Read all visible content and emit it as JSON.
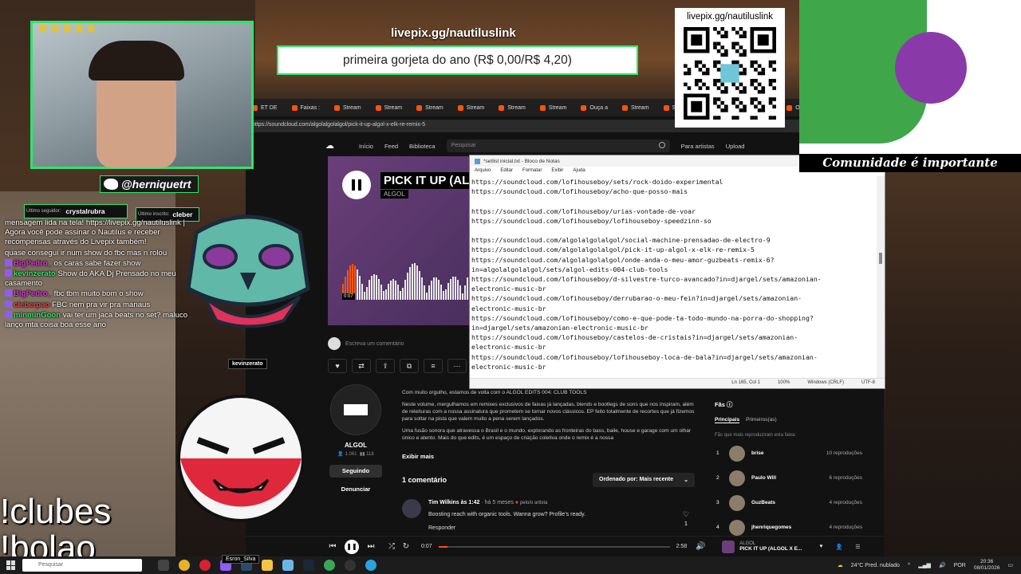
{
  "donation": {
    "url": "livepix.gg/nautiluslink",
    "goal_text": "primeira gorjeta do ano (R$ 0,00/R$ 4,20)"
  },
  "qr": {
    "label": "livepix.gg/nautiluslink"
  },
  "comic": {
    "banner": "Comunidade é importante"
  },
  "camera": {
    "rating_stars": 5
  },
  "social": {
    "twitter": "@herniquetrt",
    "last_follower_label": "Último seguidor:",
    "last_follower": "crystalrubra",
    "last_sub_label": "Último inscrito:",
    "last_sub": "cleber"
  },
  "chat": {
    "messages": [
      {
        "user": "",
        "text": "mensagem lida na tela! https://livepix.gg/nautiluslink | Agora você pode assinar o Nautilus e receber recompensas através do Livepix também!",
        "color": "#ffffff"
      },
      {
        "user": "",
        "text": "quase consegui ir num show do fbc mas n rolou",
        "color": "#8f5cf7"
      },
      {
        "user": "BigPedro_",
        "text": "os caras sabe fazer show",
        "color": "#d13bd1"
      },
      {
        "user": "kevinzerato",
        "text": "Show do AKA Dj Prensado no meu casamento",
        "color": "#2ee56b"
      },
      {
        "user": "BigPedro_",
        "text": "fbc tbm muito bom o show",
        "color": "#d13bd1"
      },
      {
        "user": "cleberpao",
        "text": "FBC nem pra vir pra manaus",
        "color": "#e24a4a"
      },
      {
        "user": "minminGoon",
        "text": "vai ter um jaca beats no set? maluco lanço mta coisa boa esse ano",
        "color": "#2ee56b"
      }
    ]
  },
  "commands": {
    "line1": "!clubes",
    "line2": "!bolao"
  },
  "name_tags": {
    "kevin": "kevinzerato",
    "esron": "Esron_Silva"
  },
  "browser": {
    "tabs": [
      "ET DE",
      "Faixas :",
      "Stream",
      "Stream",
      "Stream",
      "Stream",
      "Stream",
      "Stream",
      "Ouça a",
      "Stream",
      "Stream",
      "Stream",
      "Stream",
      "Ouça a"
    ],
    "url": "https://soundcloud.com/algolalgolalgol/pick-it-up-algol-x-elk-re-remix-5"
  },
  "soundcloud": {
    "nav": {
      "home": "Início",
      "feed": "Feed",
      "library": "Biblioteca",
      "search_placeholder": "Pesquisar",
      "for_artists": "Para artistas",
      "upload": "Upload"
    },
    "track": {
      "title": "PICK IT UP (ALG",
      "artist": "ALGOL",
      "wave_time": "0:07"
    },
    "comment_placeholder": "Escreva um comentário",
    "artist": {
      "name": "ALGOL",
      "followers": "1.061",
      "tracks": "118",
      "follow": "Seguindo",
      "report": "Denunciar"
    },
    "description": [
      "Com muito orgulho, estamos de volta com o ALGOL EDITS 004: CLUB TOOLS",
      "Neste volume, mergulhamos em remixes exclusivos de faixas já lançadas, blends e bootlegs de sons que nos inspiram, além de releituras com a nossa assinatura que prometem se tornar novos clássicos. EP feito totalmente de recortes que já fizemos para soltar na pista que valem muito a pena serem lançados.",
      "Uma fusão sonora que atravessa o Brasil e o mundo, explorando as fronteiras do bass, baile, house e garage com um olhar único e atento. Mais do que edits, é um espaço de criação coletiva onde o remix é a nossa"
    ],
    "show_more": "Exibir mais",
    "comments_count": "1 comentário",
    "sort": "Ordenado por: Mais recente",
    "comment": {
      "user": "Tim Wilkins às 1:42",
      "meta": "· há 5 meses",
      "artist_tag": "pelo/o artista",
      "text": "Boosting reach with organic tools. Wanna grow? Profile's ready.",
      "reply": "Responder",
      "likes": "1"
    },
    "fans": {
      "title": "Fãs",
      "tab_top": "Principais",
      "tab_first": "Primeiros(as)",
      "subtitle": "Fãs que mais reproduziram esta faixa:",
      "list": [
        {
          "rank": "1",
          "name": "brise",
          "plays": "10 reproduções"
        },
        {
          "rank": "2",
          "name": "Paulo Will",
          "plays": "6 reproduções"
        },
        {
          "rank": "3",
          "name": "GuzBeats",
          "plays": "4 reproduções"
        },
        {
          "rank": "4",
          "name": "jhenriquegomes",
          "plays": "4 reproduções"
        }
      ]
    },
    "player": {
      "elapsed": "0:07",
      "duration": "2:58",
      "progress": 0.04,
      "artist": "ALGOL",
      "title": "PICK IT UP (ALGOL X E..."
    }
  },
  "notepad": {
    "title": "*setlist inicial.txt - Bloco de Notas",
    "menu": [
      "Arquivo",
      "Editar",
      "Formatar",
      "Exibir",
      "Ajuda"
    ],
    "lines": [
      "https://soundcloud.com/lofihouseboy/sets/rock-doido-experimental",
      "https://soundcloud.com/lofihouseboy/acho-que-posso-mais",
      "",
      "https://soundcloud.com/lofihouseboy/urias-vontade-de-voar",
      "https://soundcloud.com/lofihouseboy/lofihouseboy-speedzinn-so",
      "",
      "https://soundcloud.com/algolalgolalgol/social-machine-prensadao-de-electro-9",
      "https://soundcloud.com/algolalgolalgol/pick-it-up-algol-x-elk-re-remix-5",
      "https://soundcloud.com/algolalgolalgol/onde-anda-o-meu-amor-guzbeats-remix-6?",
      "in=algolalgolalgol/sets/algol-edits-004-club-tools",
      "https://soundcloud.com/lofihouseboy/d-silvestre-turco-avancado?in=djargel/sets/amazonian-",
      "electronic-music-br",
      "https://soundcloud.com/lofihouseboy/derrubarao-o-meu-fein?in=djargel/sets/amazonian-",
      "electronic-music-br",
      "https://soundcloud.com/lofihouseboy/como-e-que-pode-ta-todo-mundo-na-porra-do-shopping?",
      "in=djargel/sets/amazonian-electronic-music-br",
      "https://soundcloud.com/lofihouseboy/castelos-de-cristais?in=djargel/sets/amazonian-",
      "electronic-music-br",
      "https://soundcloud.com/lofihouseboy/lofihouseboy-loca-de-bala?in=djargel/sets/amazonian-",
      "electronic-music-br"
    ],
    "status": {
      "position": "Ln 165, Col 1",
      "zoom": "100%",
      "eol": "Windows (CRLF)",
      "encoding": "UTF-8"
    }
  },
  "taskbar": {
    "search_placeholder": "Pesquisar",
    "weather": "24°C  Pred. nublado",
    "lang": "POR",
    "time": "20:36",
    "date": "08/01/2026"
  }
}
